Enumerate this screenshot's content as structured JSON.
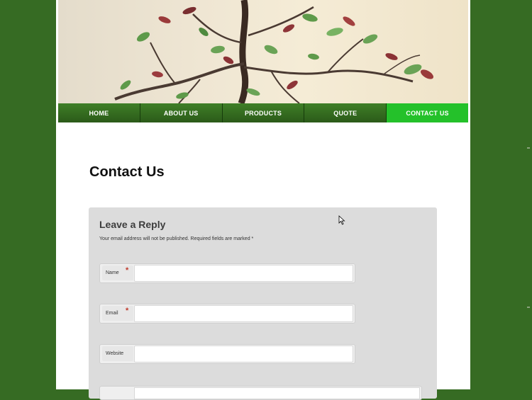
{
  "nav": {
    "items": [
      {
        "label": "HOME",
        "active": false
      },
      {
        "label": "ABOUT US",
        "active": false
      },
      {
        "label": "PRODUCTS",
        "active": false
      },
      {
        "label": "QUOTE",
        "active": false
      },
      {
        "label": "CONTACT US",
        "active": true
      }
    ]
  },
  "page": {
    "title": "Contact Us"
  },
  "reply": {
    "title": "Leave a Reply",
    "note": "Your email address will not be published. Required fields are marked *",
    "fields": [
      {
        "label": "Name",
        "required": true
      },
      {
        "label": "Email",
        "required": true
      },
      {
        "label": "Website",
        "required": false
      }
    ]
  },
  "colors": {
    "background": "#366b23",
    "nav": "#2b5a19",
    "nav_active": "#24c12a",
    "required": "#c0392b"
  }
}
